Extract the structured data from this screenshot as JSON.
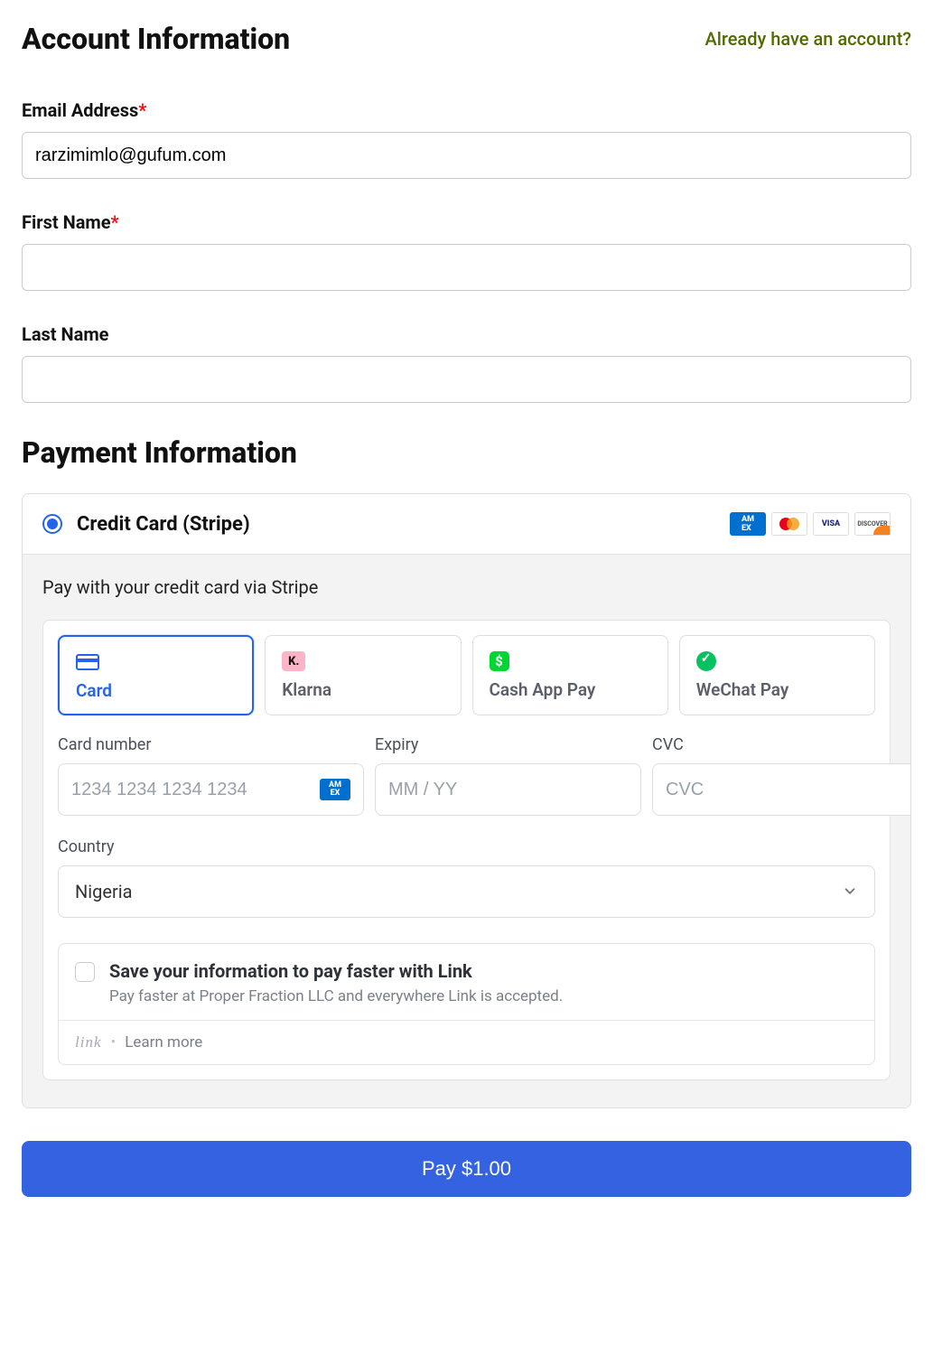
{
  "account": {
    "heading": "Account Information",
    "already_label": "Already have an account?",
    "email_label": "Email Address",
    "email_value": "rarzimimlo@gufum.com",
    "first_name_label": "First Name",
    "first_name_value": "",
    "last_name_label": "Last Name",
    "last_name_value": ""
  },
  "payment": {
    "heading": "Payment Information",
    "method_label": "Credit Card (Stripe)",
    "description": "Pay with your credit card via Stripe",
    "brand_icons": [
      "amex",
      "mastercard",
      "visa",
      "discover"
    ],
    "tabs": [
      {
        "id": "card",
        "label": "Card",
        "active": true
      },
      {
        "id": "klarna",
        "label": "Klarna",
        "active": false
      },
      {
        "id": "cashapp",
        "label": "Cash App Pay",
        "active": false
      },
      {
        "id": "wechat",
        "label": "WeChat Pay",
        "active": false
      }
    ],
    "fields": {
      "card_number": {
        "label": "Card number",
        "placeholder": "1234 1234 1234 1234",
        "value": ""
      },
      "expiry": {
        "label": "Expiry",
        "placeholder": "MM / YY",
        "value": ""
      },
      "cvc": {
        "label": "CVC",
        "placeholder": "CVC",
        "value": ""
      },
      "country": {
        "label": "Country",
        "value": "Nigeria"
      }
    },
    "save_link": {
      "title": "Save your information to pay faster with Link",
      "subtitle": "Pay faster at Proper Fraction LLC and everywhere Link is accepted.",
      "brand": "link",
      "learn_more": "Learn more"
    }
  },
  "pay_button_label": "Pay $1.00"
}
